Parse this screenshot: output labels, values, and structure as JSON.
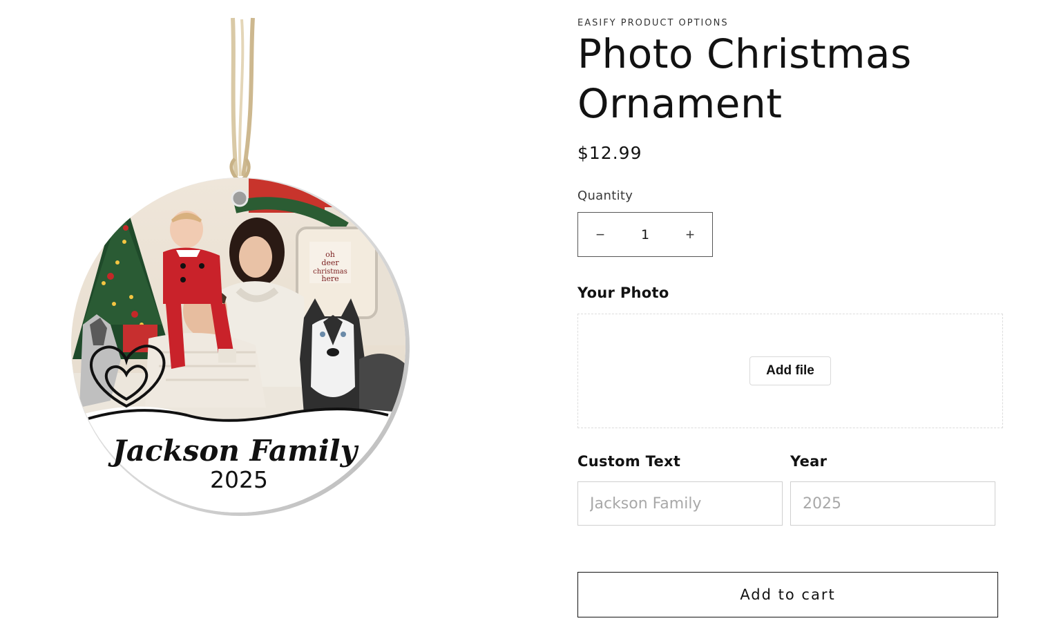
{
  "product": {
    "vendor": "EASIFY PRODUCT OPTIONS",
    "title": "Photo Christmas Ornament",
    "price": "$12.99"
  },
  "quantity": {
    "label": "Quantity",
    "value": "1",
    "decrease_symbol": "−",
    "increase_symbol": "+"
  },
  "photo_option": {
    "label": "Your Photo",
    "button_label": "Add file"
  },
  "custom_text": {
    "label": "Custom Text",
    "placeholder": "Jackson Family"
  },
  "year": {
    "label": "Year",
    "placeholder": "2025"
  },
  "cart": {
    "button_label": "Add to cart"
  },
  "ornament": {
    "name_text": "Jackson Family",
    "year_text": "2025"
  },
  "icons": {
    "minus": "minus-icon",
    "plus": "plus-icon",
    "heart": "double-heart-icon"
  },
  "colors": {
    "text": "#121212",
    "border": "#555555",
    "dashed_border": "#dcdcdc",
    "background": "#ffffff"
  }
}
